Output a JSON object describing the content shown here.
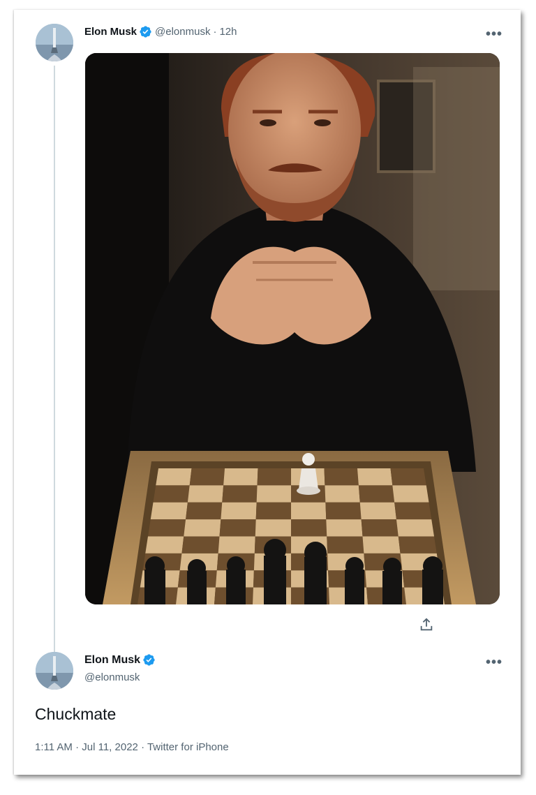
{
  "tweet_parent": {
    "name": "Elon Musk",
    "handle": "@elonmusk",
    "separator": "·",
    "time_ago": "12h",
    "more_label": "•••",
    "image_icon": "chess-photo",
    "share_icon": "share-icon"
  },
  "tweet_reply": {
    "name": "Elon Musk",
    "handle": "@elonmusk",
    "more_label": "•••",
    "text": "Chuckmate",
    "time": "1:11 AM",
    "date": "Jul 11, 2022",
    "source": "Twitter for iPhone",
    "sep": "·"
  },
  "colors": {
    "verified_blue": "#1d9bf0",
    "muted_text": "#536471",
    "thread_line": "#cfd9de"
  }
}
